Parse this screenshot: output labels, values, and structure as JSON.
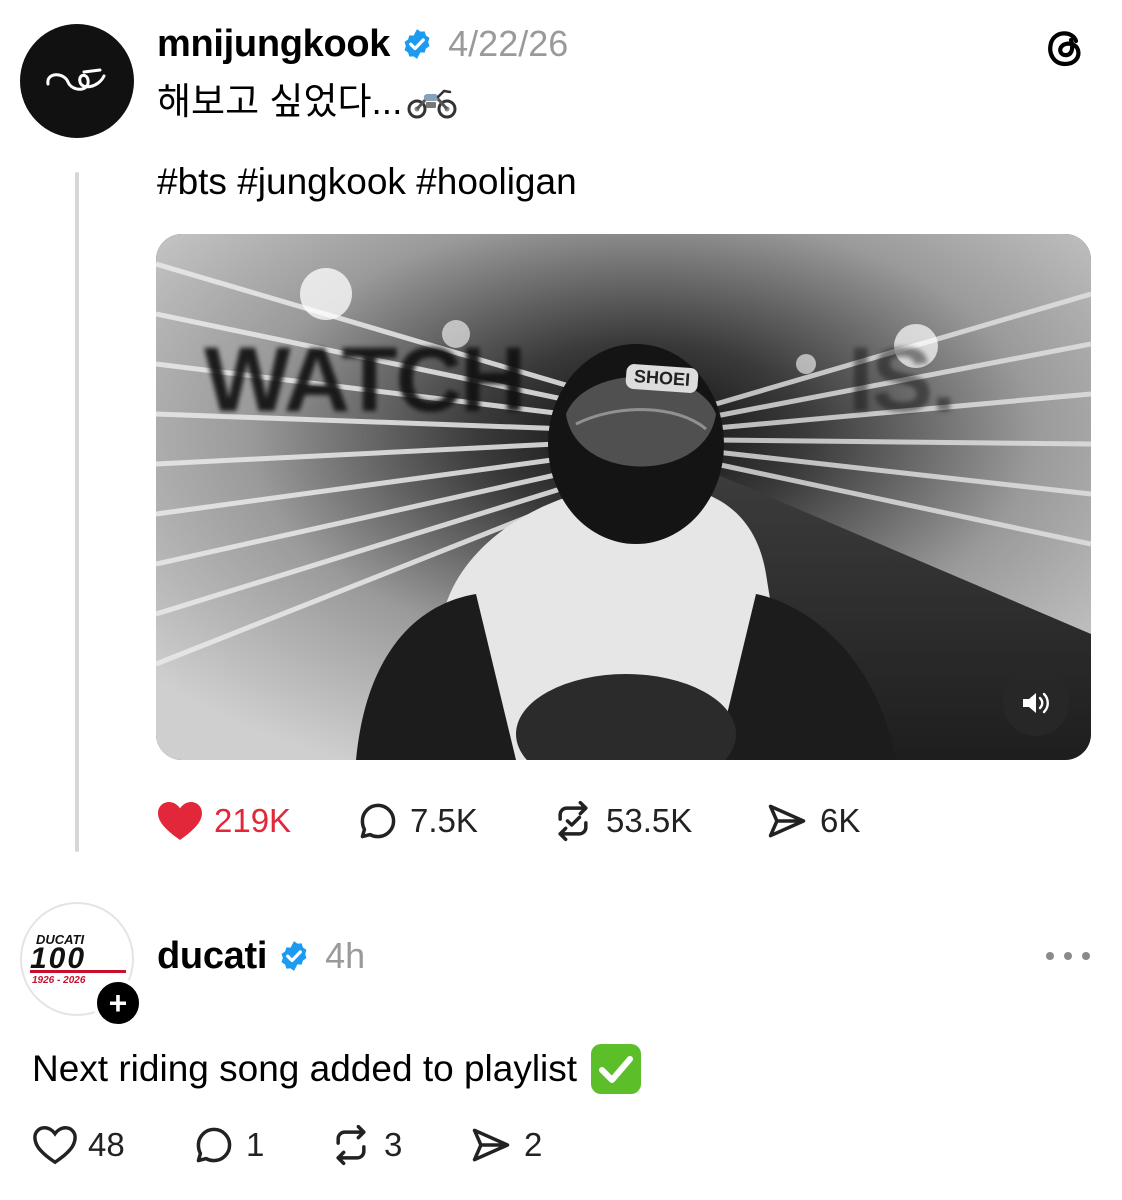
{
  "post1": {
    "username": "mnijungkook",
    "timestamp": "4/22/26",
    "text_line1": "해보고 싶었다...",
    "hashtags": "#bts #jungkook #hooligan",
    "video": {
      "overlay_text": "WATCH",
      "overlay_text_end": "IS.",
      "helmet_brand": "SHOEI"
    },
    "actions": {
      "likes": "219K",
      "replies": "7.5K",
      "reposts": "53.5K",
      "shares": "6K"
    },
    "like_color": "#e3273a"
  },
  "post2": {
    "username": "ducati",
    "timestamp": "4h",
    "avatar_brand": "DUCATI",
    "avatar_mark": "100",
    "avatar_years": "1926 - 2026",
    "text": "Next riding song added to playlist",
    "actions": {
      "likes": "48",
      "replies": "1",
      "reposts": "3",
      "shares": "2"
    }
  },
  "colors": {
    "verified": "#1d9bf0",
    "muted": "#9a9a9a",
    "ducati_red": "#c8102e"
  },
  "icons": [
    "threads-logo-icon",
    "verified-icon",
    "motorcycle-emoji-icon",
    "volume-icon",
    "heart-icon",
    "reply-icon",
    "repost-icon",
    "share-icon",
    "more-icon",
    "plus-icon",
    "check-emoji-icon"
  ]
}
